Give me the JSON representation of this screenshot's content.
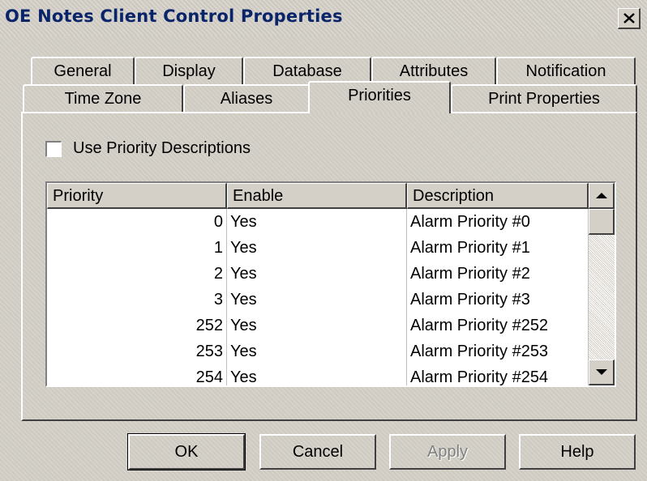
{
  "window": {
    "title": "OE Notes Client Control Properties"
  },
  "tabs_row1": [
    "General",
    "Display",
    "Database",
    "Attributes",
    "Notification"
  ],
  "tabs_row2": [
    "Time Zone",
    "Aliases",
    "Priorities",
    "Print Properties"
  ],
  "active_tab": "Priorities",
  "checkbox": {
    "label": "Use Priority Descriptions",
    "checked": false
  },
  "table": {
    "columns": [
      "Priority",
      "Enable",
      "Description"
    ],
    "rows": [
      {
        "priority": "0",
        "enable": "Yes",
        "description": "Alarm Priority #0"
      },
      {
        "priority": "1",
        "enable": "Yes",
        "description": "Alarm Priority #1"
      },
      {
        "priority": "2",
        "enable": "Yes",
        "description": "Alarm Priority #2"
      },
      {
        "priority": "3",
        "enable": "Yes",
        "description": "Alarm Priority #3"
      },
      {
        "priority": "252",
        "enable": "Yes",
        "description": "Alarm Priority #252"
      },
      {
        "priority": "253",
        "enable": "Yes",
        "description": "Alarm Priority #253"
      },
      {
        "priority": "254",
        "enable": "Yes",
        "description": "Alarm Priority #254"
      }
    ]
  },
  "buttons": {
    "ok": "OK",
    "cancel": "Cancel",
    "apply": "Apply",
    "help": "Help"
  },
  "icons": {
    "close": "close-icon",
    "scroll_up": "scroll-up-arrow-icon",
    "scroll_down": "scroll-down-arrow-icon"
  }
}
